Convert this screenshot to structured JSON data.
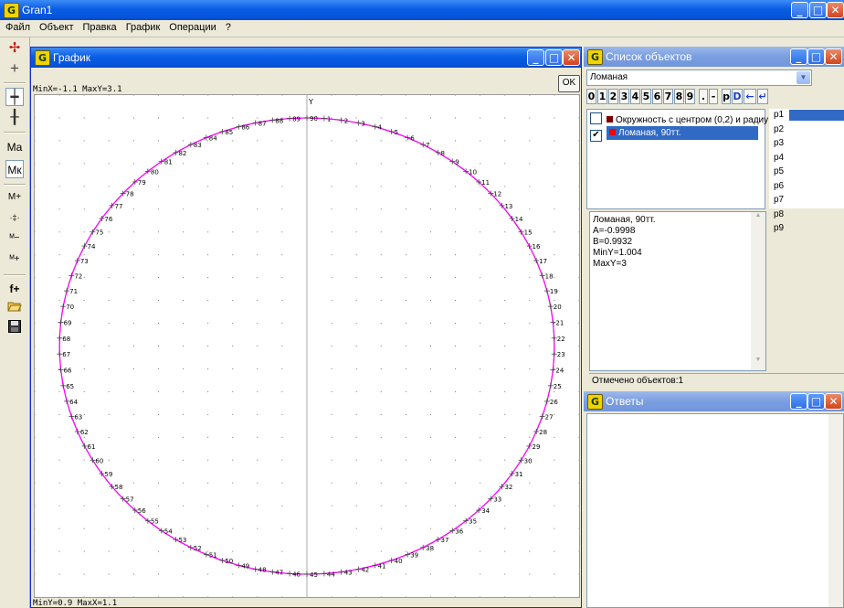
{
  "app": {
    "title": "Gran1",
    "icon": "gran-app-icon"
  },
  "menu": [
    "Файл",
    "Объект",
    "Правка",
    "График",
    "Операции",
    "?"
  ],
  "toolbar_icons": [
    "angle-tool-icon",
    "cross-tool-icon",
    "axes-tool-icon",
    "grid-tool-icon",
    "m-a-icon",
    "m-k-icon",
    "m-plus-icon",
    "scale-icon",
    "m-minus-icon",
    "m-plus2-icon",
    "f-plus-icon",
    "open-folder-icon",
    "save-disk-icon"
  ],
  "toolbar_labels": {
    "ma": "Ma",
    "mk": "Mк",
    "mplus": "M+",
    "fplus": "f+"
  },
  "graph": {
    "title": "График",
    "ok_label": "OK",
    "top_label": "MinX=-1.1  MaxY=3.1",
    "bottom_label": "MinY=0.9  MaxX=1.1",
    "axis_label": "Y",
    "circle_center": [
      0,
      2
    ],
    "circle_radius": 1,
    "polyline_points": 90,
    "x_range": [
      -1.1,
      1.1
    ],
    "y_range": [
      0.9,
      3.1
    ],
    "curve_color": "#ff00ff",
    "label_start": "50",
    "point_prefix": ""
  },
  "objects": {
    "title": "Список объектов",
    "combo_value": "Ломаная",
    "keypad": [
      "0",
      "1",
      "2",
      "3",
      "4",
      "5",
      "6",
      "7",
      "8",
      "9",
      ".",
      "-",
      "p",
      "D",
      "←",
      "↵"
    ],
    "items": [
      {
        "label": "Окружность с центром (0,2) и радиу",
        "checked": false,
        "selected": false
      },
      {
        "label": "Ломаная, 90тт.",
        "checked": true,
        "selected": true
      }
    ],
    "params": [
      "p1",
      "p2",
      "p3",
      "p4",
      "p5",
      "p6",
      "p7",
      "p8",
      "p9"
    ],
    "info": [
      "Ломаная, 90тт.",
      "A=-0.9998",
      "B=0.9932",
      "MinY=1.004",
      "MaxY=3"
    ],
    "status": "Отмечено объектов:1"
  },
  "answers": {
    "title": "Ответы"
  },
  "colors": {
    "titlebar": "#0a5de6",
    "selection": "#316ac5",
    "curve": "#ff00ff"
  }
}
